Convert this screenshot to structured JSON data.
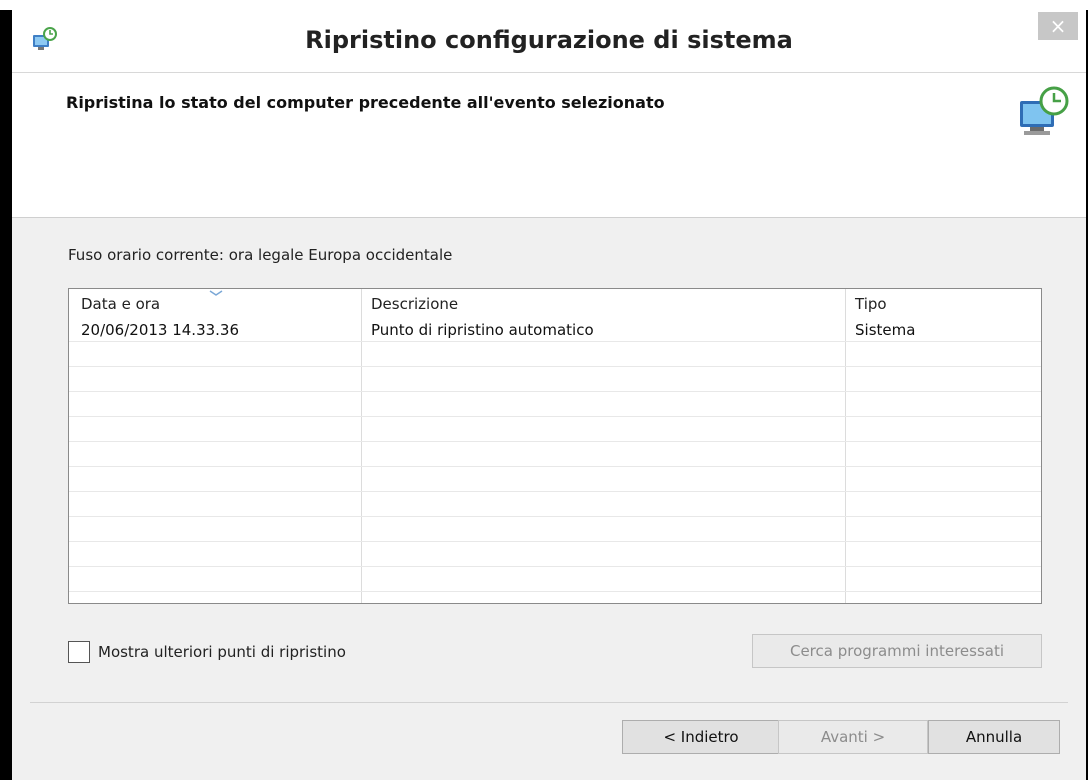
{
  "window": {
    "title": "Ripristino configurazione di sistema",
    "close_glyph": "×"
  },
  "header": {
    "heading": "Ripristina lo stato del computer precedente all'evento selezionato",
    "icon": "system-restore-icon"
  },
  "timezone_text": "Fuso orario corrente: ora legale Europa occidentale",
  "table": {
    "columns": [
      "Data e ora",
      "Descrizione",
      "Tipo"
    ],
    "sorted_column": "Data e ora",
    "rows": [
      [
        "20/06/2013 14.33.36",
        "Punto di ripristino automatico",
        "Sistema"
      ],
      [
        "",
        "",
        ""
      ],
      [
        "",
        "",
        ""
      ],
      [
        "",
        "",
        ""
      ],
      [
        "",
        "",
        ""
      ],
      [
        "",
        "",
        ""
      ],
      [
        "",
        "",
        ""
      ],
      [
        "",
        "",
        ""
      ],
      [
        "",
        "",
        ""
      ],
      [
        "",
        "",
        ""
      ],
      [
        "",
        "",
        ""
      ]
    ]
  },
  "checkbox": {
    "label": "Mostra ulteriori punti di ripristino",
    "checked": false
  },
  "buttons": {
    "search_programs": "Cerca programmi interessati",
    "back": "< Indietro",
    "next": "Avanti >",
    "cancel": "Annulla"
  },
  "colors": {
    "titlebar_bg": "#ffffff",
    "window_bg": "#f0f0f0",
    "close_btn_bg": "#c7c7c7"
  }
}
